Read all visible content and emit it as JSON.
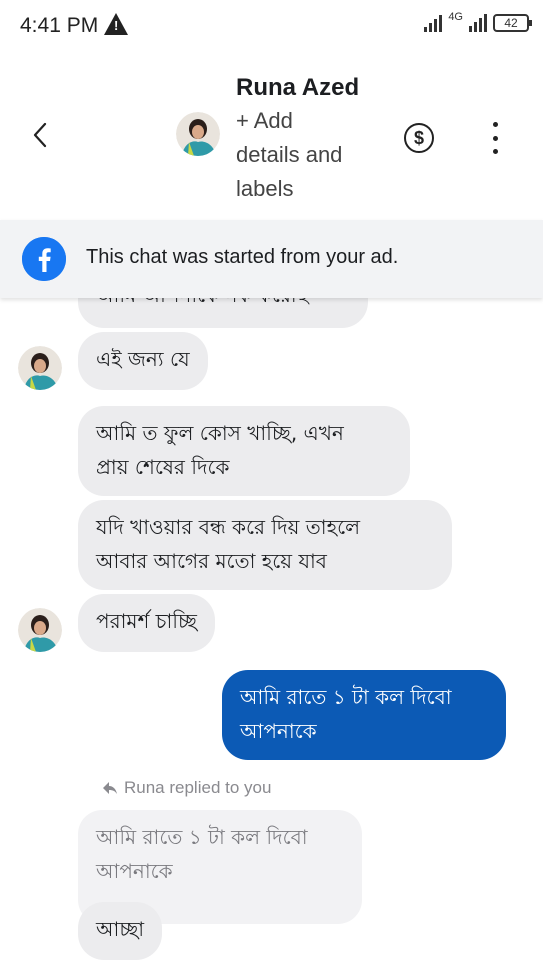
{
  "status_bar": {
    "time": "4:41 PM",
    "network_label": "4G",
    "battery": "42"
  },
  "header": {
    "contact_name": "Runa Azed",
    "subtitle": "+ Add\ndetails and\nlabels",
    "currency_symbol": "$"
  },
  "banner": {
    "text": "This chat was started from your ad."
  },
  "messages": [
    {
      "direction": "incoming",
      "text": "আমি আপনাকে নক করেছি"
    },
    {
      "direction": "incoming",
      "text": "এই জন্য যে"
    },
    {
      "direction": "incoming",
      "text": "আমি ত ফুল কোস খাচ্ছি, এখন\nপ্রায় শেষের দিকে"
    },
    {
      "direction": "incoming",
      "text": "যদি খাওয়ার বন্ধ করে দিয় তাহলে\nআবার আগের মতো হয়ে যাব"
    },
    {
      "direction": "incoming",
      "text": "পরামর্শ চাচ্ছি"
    },
    {
      "direction": "outgoing",
      "text": "আমি রাতে ১ টা কল দিবো\nআপনাকে"
    }
  ],
  "reply": {
    "label": "Runa replied to you",
    "quoted_text": "আমি রাতে ১ টা কল দিবো\nআপনাকে",
    "text": "আচ্ছা"
  },
  "colors": {
    "outgoing_bubble": "#0c5ab5",
    "incoming_bubble": "#ececee",
    "facebook_blue": "#1877f2"
  }
}
